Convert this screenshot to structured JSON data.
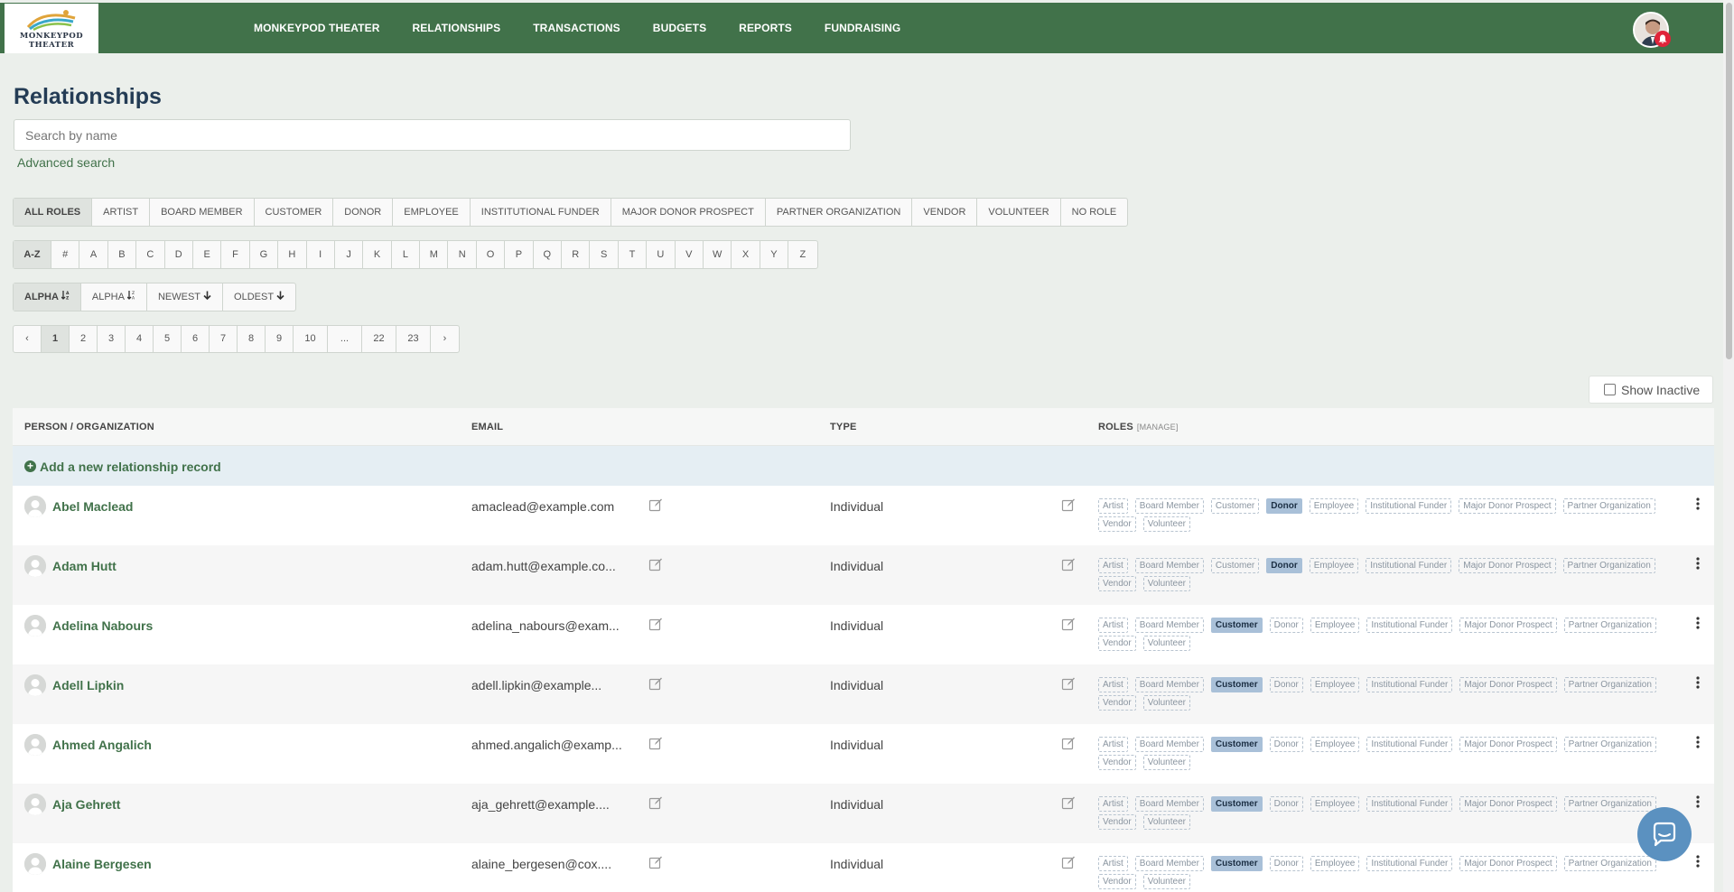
{
  "app": {
    "logo_line1": "MONKEYPOD",
    "logo_line2": "THEATER",
    "nav": [
      "MONKEYPOD THEATER",
      "RELATIONSHIPS",
      "TRANSACTIONS",
      "BUDGETS",
      "REPORTS",
      "FUNDRAISING"
    ]
  },
  "page": {
    "title": "Relationships",
    "search_placeholder": "Search by name",
    "advanced_search": "Advanced search",
    "show_inactive": "Show Inactive"
  },
  "filters": {
    "roles": [
      "ALL ROLES",
      "ARTIST",
      "BOARD MEMBER",
      "CUSTOMER",
      "DONOR",
      "EMPLOYEE",
      "INSTITUTIONAL FUNDER",
      "MAJOR DONOR PROSPECT",
      "PARTNER ORGANIZATION",
      "VENDOR",
      "VOLUNTEER",
      "NO ROLE"
    ],
    "active_role": "ALL ROLES",
    "letters": [
      "A-Z",
      "#",
      "A",
      "B",
      "C",
      "D",
      "E",
      "F",
      "G",
      "H",
      "I",
      "J",
      "K",
      "L",
      "M",
      "N",
      "O",
      "P",
      "Q",
      "R",
      "S",
      "T",
      "U",
      "V",
      "W",
      "X",
      "Y",
      "Z"
    ],
    "active_letter": "A-Z",
    "sorts": [
      "ALPHA",
      "ALPHA",
      "NEWEST",
      "OLDEST"
    ],
    "active_sort_index": 0
  },
  "pagination": {
    "prev": "‹",
    "pages": [
      "1",
      "2",
      "3",
      "4",
      "5",
      "6",
      "7",
      "8",
      "9",
      "10",
      "...",
      "22",
      "23"
    ],
    "next": "›",
    "current": "1"
  },
  "table": {
    "headers": {
      "person": "PERSON / ORGANIZATION",
      "email": "EMAIL",
      "type": "TYPE",
      "roles": "ROLES",
      "manage": "[MANAGE]"
    },
    "add_label": "Add a new relationship record",
    "role_names": [
      "Artist",
      "Board Member",
      "Customer",
      "Donor",
      "Employee",
      "Institutional Funder",
      "Major Donor Prospect",
      "Partner Organization",
      "Vendor",
      "Volunteer"
    ],
    "rows": [
      {
        "name": "Abel Maclead",
        "email": "amaclead@example.com",
        "type": "Individual",
        "active_roles": [
          "Donor"
        ]
      },
      {
        "name": "Adam Hutt",
        "email": "adam.hutt@example.co...",
        "type": "Individual",
        "active_roles": [
          "Donor"
        ]
      },
      {
        "name": "Adelina Nabours",
        "email": "adelina_nabours@exam...",
        "type": "Individual",
        "active_roles": [
          "Customer"
        ]
      },
      {
        "name": "Adell Lipkin",
        "email": "adell.lipkin@example...",
        "type": "Individual",
        "active_roles": [
          "Customer"
        ]
      },
      {
        "name": "Ahmed Angalich",
        "email": "ahmed.angalich@examp...",
        "type": "Individual",
        "active_roles": [
          "Customer"
        ]
      },
      {
        "name": "Aja Gehrett",
        "email": "aja_gehrett@example....",
        "type": "Individual",
        "active_roles": [
          "Customer"
        ]
      },
      {
        "name": "Alaine Bergesen",
        "email": "alaine_bergesen@cox....",
        "type": "Individual",
        "active_roles": [
          "Customer"
        ]
      }
    ]
  },
  "colors": {
    "brand_green": "#41724a",
    "role_active": "#a9c0d8",
    "chat_blue": "#5b91c0",
    "badge_red": "#e0243a"
  },
  "icons": [
    "bell-icon",
    "sort-alpha-asc-icon",
    "sort-alpha-desc-icon",
    "arrow-down-icon",
    "plus-circle-icon",
    "edit-icon",
    "kebab-icon",
    "chat-icon",
    "avatar-placeholder-icon"
  ]
}
